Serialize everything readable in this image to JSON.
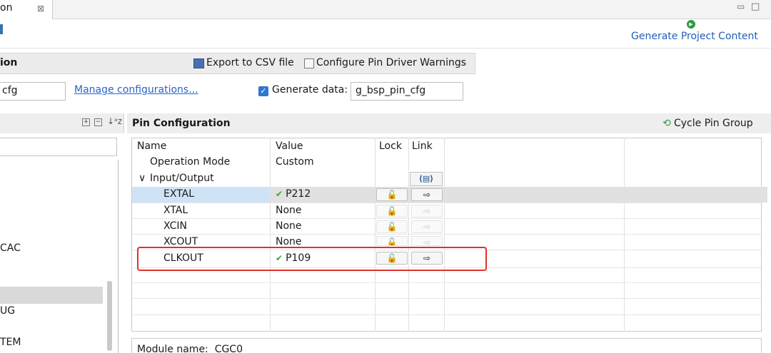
{
  "tab": {
    "label": "on",
    "close_glyph": "⊠"
  },
  "window_controls": {
    "minimize": "▭",
    "maximize": "□"
  },
  "header": {
    "generate_icon": "play-icon",
    "generate_label": "Generate Project Content"
  },
  "selection": {
    "title": "ion",
    "export_label": "Export to CSV file",
    "configure_warnings_label": "Configure Pin Driver Warnings",
    "config_name": "cfg",
    "manage_link": "Manage configurations...",
    "generate_data_checked": true,
    "generate_data_label": "Generate data:",
    "generate_data_value": "g_bsp_pin_cfg"
  },
  "left_pane": {
    "tool_icons": [
      "expand-all-icon",
      "collapse-all-icon",
      "sort-icon"
    ],
    "filter_value": "",
    "tree_items": [
      {
        "label": "CAC"
      },
      {
        "label": "UG"
      },
      {
        "label": "TEM"
      }
    ]
  },
  "pin_config": {
    "title": "Pin Configuration",
    "cycle_label": "Cycle Pin Group",
    "columns": {
      "name": "Name",
      "value": "Value",
      "lock": "Lock",
      "link": "Link"
    },
    "link_all_glyph": "⟨▤⟩",
    "rows": [
      {
        "name": "Operation Mode",
        "value": "Custom",
        "checked": false,
        "lock": false,
        "link": false
      },
      {
        "name": "Input/Output",
        "value": "",
        "group": true,
        "expanded": true
      },
      {
        "name": "EXTAL",
        "value": "P212",
        "checked": true,
        "lock": true,
        "enabled": true,
        "selected": true
      },
      {
        "name": "XTAL",
        "value": "None",
        "checked": false,
        "lock": true,
        "enabled": false
      },
      {
        "name": "XCIN",
        "value": "None",
        "checked": false,
        "lock": true,
        "enabled": false
      },
      {
        "name": "XCOUT",
        "value": "None",
        "checked": false,
        "lock": true,
        "enabled": false
      },
      {
        "name": "CLKOUT",
        "value": "P109",
        "checked": true,
        "lock": true,
        "enabled": true,
        "highlighted": true
      }
    ],
    "highlight_color": "#e3302a"
  },
  "module": {
    "label": "Module name:",
    "value": "CGC0"
  }
}
